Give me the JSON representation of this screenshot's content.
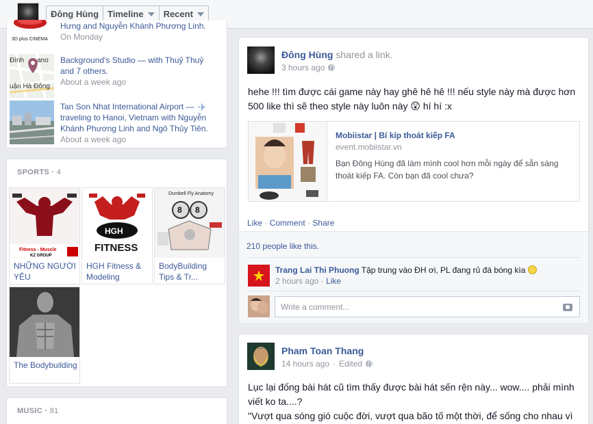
{
  "header": {
    "user_name": "Đông Hùng",
    "nav": [
      {
        "label": "Đông Hùng"
      },
      {
        "label": "Timeline"
      },
      {
        "label": "Recent"
      }
    ]
  },
  "places": [
    {
      "text": "Hưng and Nguyễn Khánh Phương Linh.",
      "time": "On Monday",
      "thumb_label": "3D plus CINEMA"
    },
    {
      "text": "Background's Studio — with Thuỷ Thuỷ and 7 others.",
      "time": "About a week ago",
      "map_labels": [
        "Đình",
        "ano",
        "Luận Hà Đông"
      ]
    },
    {
      "text": "Tan Son Nhat International Airport — traveling to Hanoi, Vietnam with Nguyễn Khánh Phương Linh and Ngô Thủy Tiên.",
      "time": "About a week ago"
    }
  ],
  "sports": {
    "title": "SPORTS",
    "count": "4",
    "items": [
      {
        "label": "NHỮNG NGƯỜI YÊU",
        "img_caption": "Fitness - Muscle",
        "img_caption2": "KZ GROUP"
      },
      {
        "label": "HGH Fitness & Modeling",
        "img_caption": "HGH",
        "img_caption2": "FITNESS"
      },
      {
        "label": "BodyBuilding Tips & Tr...",
        "img_caption": "Dumbell Fly Anatomy"
      },
      {
        "label": "The Bodybuilding"
      }
    ]
  },
  "music": {
    "title": "MUSIC",
    "count": "81"
  },
  "post1": {
    "author": "Đông Hùng",
    "action": "shared a link.",
    "time": "3 hours ago",
    "body": "hehe !!! tìm được cái game này hay ghê hê hê !!! nếu style này mà được hơn 500 like thì sẽ theo style này luôn này 😲 hí hí :x",
    "link": {
      "title": "Mobiistar | Bí kíp thoát kiếp FA",
      "domain": "event.mobiistar.vn",
      "description": "Bạn Đông Hùng đã làm mình cool hơn mỗi ngày để sẵn sàng thoát kiếp FA. Còn bạn đã cool chưa?"
    },
    "actions": [
      "Like",
      "Comment",
      "Share"
    ],
    "likes": "210 people like this.",
    "comment": {
      "author": "Trang Lai Thi Phuong",
      "text": "Tập trung vào ĐH ơi, PL đang rủ đá bóng kìa",
      "time": "2 hours ago",
      "like": "Like"
    },
    "write_placeholder": "Write a comment..."
  },
  "post2": {
    "author": "Pham Toan Thang",
    "time": "14 hours ago",
    "edited": "Edited",
    "body_line1": "Lục lại đống bài hát cũ tìm thấy được bài hát sến rện này... wow.... phải mình viết ko ta....?",
    "body_line2": "\"Vượt qua sóng gió cuộc đời, vượt qua bão tố một thời, để sống cho nhau vì"
  },
  "colors": {
    "link_blue": "#3b5998",
    "meta_gray": "#90949c",
    "page_bg": "#e9ebee"
  }
}
